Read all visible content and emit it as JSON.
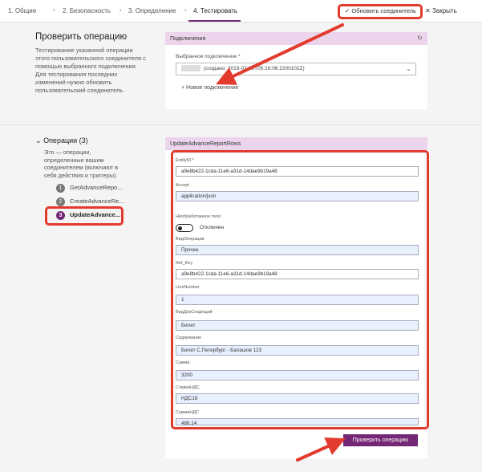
{
  "tabs": [
    {
      "label": "1. Общие"
    },
    {
      "label": "2. Безопасность"
    },
    {
      "label": "3. Определение"
    },
    {
      "label": "4. Тестировать"
    }
  ],
  "toolbar": {
    "update_label": "Обновить соединитель",
    "close_label": "Закрыть"
  },
  "test_section": {
    "title": "Проверить операцию",
    "description": "Тестирование указанной операции этого пользовательского соединителя с помощью выбранного подключения. Для тестирования последних изменений нужно обновить пользовательский соединитель."
  },
  "connections": {
    "header": "Подключения",
    "selected_label": "Выбранное подключение *",
    "selected_value": "(создано: 2019-07-09T05:16:08.2200102Z)",
    "new_connection_label": "Новое подключение"
  },
  "operations": {
    "header": "Операции (3)",
    "description": "Это — операции, определенные вашим соединителем (включают в себя действия и триггеры).",
    "items": [
      {
        "num": "1",
        "label": "GetAdvanceRepo..."
      },
      {
        "num": "2",
        "label": "CreateAdvanceRe..."
      },
      {
        "num": "3",
        "label": "UpdateAdvance..."
      }
    ]
  },
  "form": {
    "header": "UpdateAdvanceReportRows",
    "fields": [
      {
        "label": "EntityID *",
        "value": "a9e8b422-1cda-11e6-a31d-14dae9b19a48"
      },
      {
        "label": "Accept",
        "value": "application/json"
      },
      {
        "label": "Необработанное тело",
        "value": "Отключен"
      },
      {
        "label": "ВидОперации",
        "value": "Прочее"
      },
      {
        "label": "Ref_Key",
        "value": "a9e8b422-1cda-11e6-a31d-14dae9b19a48"
      },
      {
        "label": "LineNumber",
        "value": "1"
      },
      {
        "label": "ВидДокСходящий",
        "value": "Билет"
      },
      {
        "label": "Содержание",
        "value": "Билет С.Петербург - Балашов 123"
      },
      {
        "label": "Сумма",
        "value": "3200"
      },
      {
        "label": "СтавкаНДС",
        "value": "НДС18"
      },
      {
        "label": "СуммаНДС",
        "value": "488.14"
      }
    ],
    "test_button_label": "Проверить операцию"
  },
  "colors": {
    "accent": "#742774",
    "card_header": "#ecd5ec",
    "annotation_red": "#e23b2e",
    "input_fill": "#e8f0fe"
  }
}
